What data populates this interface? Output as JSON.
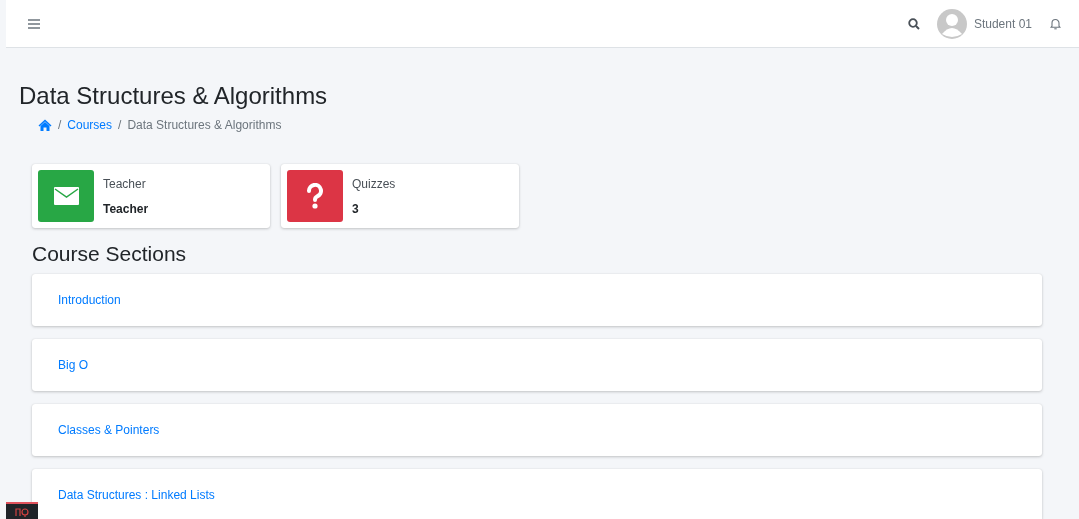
{
  "navbar": {
    "user_name": "Student 01"
  },
  "page": {
    "title": "Data Structures & Algorithms",
    "breadcrumb_separator": "/",
    "breadcrumb": [
      {
        "label": "Courses",
        "kind": "link"
      },
      {
        "label": "Data Structures & Algorithms",
        "kind": "current"
      }
    ]
  },
  "info_boxes": [
    {
      "label": "Teacher",
      "value": "Teacher",
      "kind": "mail",
      "color": "#28a745"
    },
    {
      "label": "Quizzes",
      "value": "3",
      "kind": "question",
      "color": "#dc3545"
    }
  ],
  "sections": {
    "heading": "Course Sections",
    "items": [
      "Introduction",
      "Big O",
      "Classes & Pointers",
      "Data Structures : Linked Lists"
    ]
  }
}
